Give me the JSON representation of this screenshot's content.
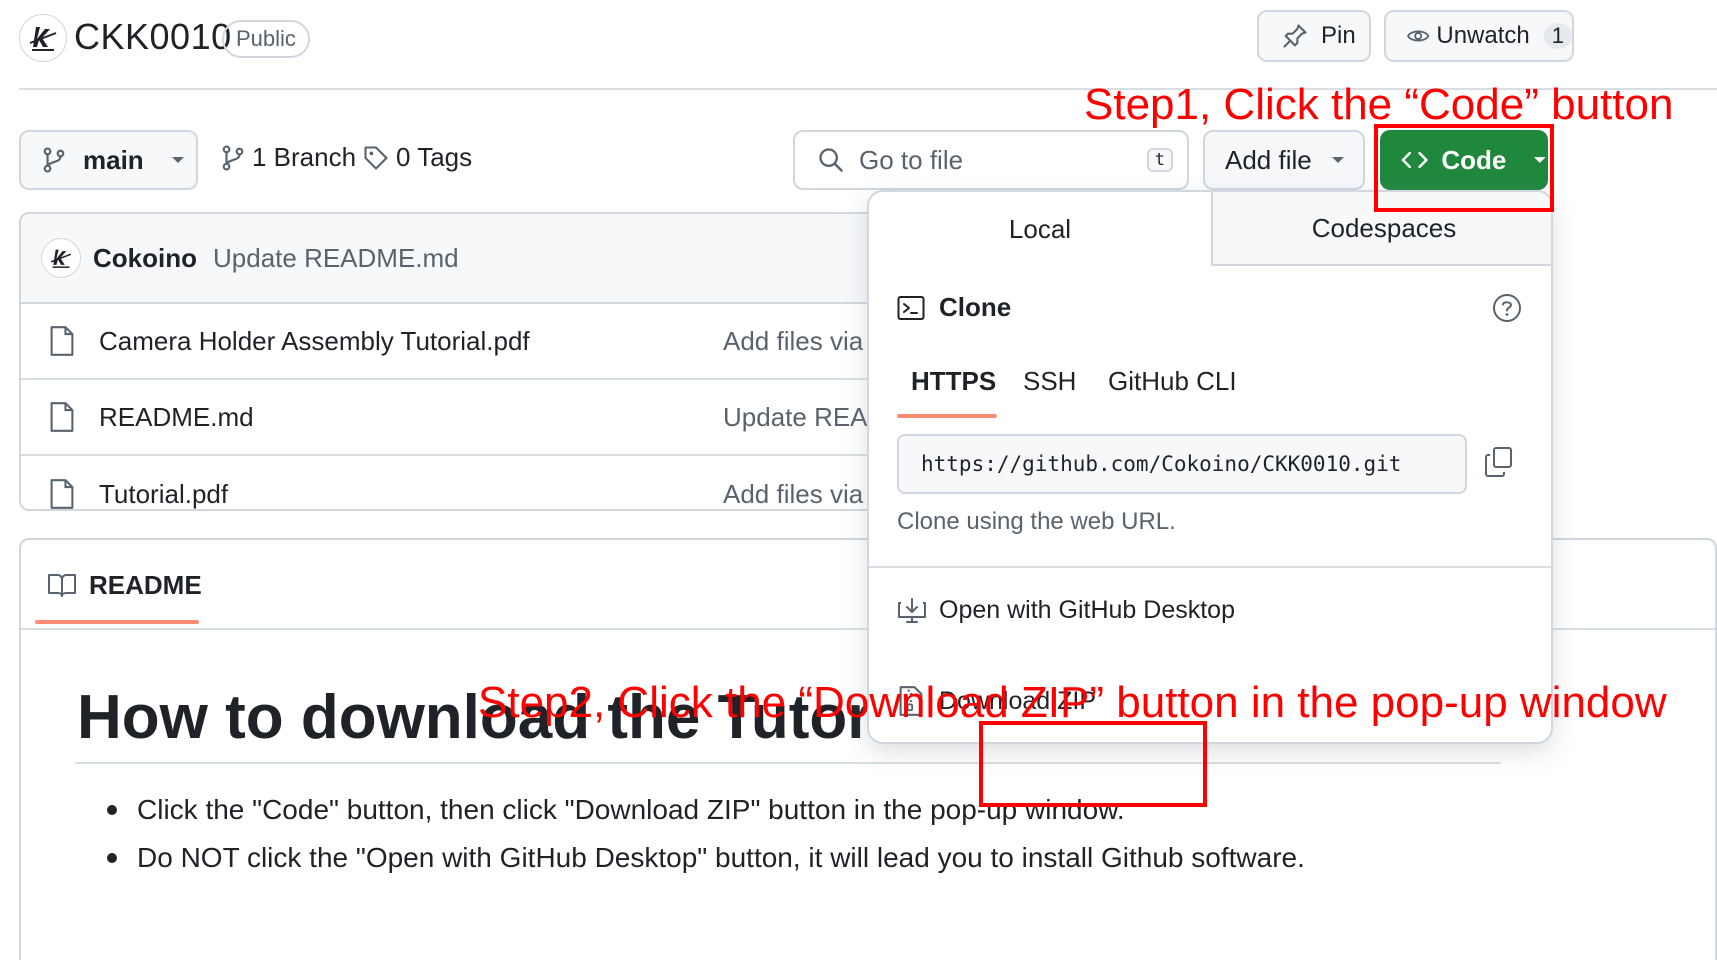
{
  "repo": {
    "name": "CKK0010",
    "visibility": "Public",
    "pin_label": "Pin",
    "unwatch_label": "Unwatch",
    "watch_count": "1"
  },
  "toolbar": {
    "branch": "main",
    "branches_count": "1 Branch",
    "tags_count": "0 Tags",
    "search_placeholder": "Go to file",
    "search_shortcut": "t",
    "add_file_label": "Add file",
    "code_label": "Code"
  },
  "commit": {
    "author": "Cokoino",
    "message": "Update README.md"
  },
  "files": [
    {
      "name": "Camera Holder Assembly Tutorial.pdf",
      "message": "Add files via upload"
    },
    {
      "name": "README.md",
      "message": "Update README.md"
    },
    {
      "name": "Tutorial.pdf",
      "message": "Add files via upload"
    }
  ],
  "readme": {
    "tab_label": "README",
    "heading": "How to download the Tutorial d",
    "bullets": [
      "Click the \"Code\" button, then click \"Download ZIP\" button in the pop-up window.",
      "Do NOT click the \"Open with GitHub Desktop\" button, it will lead you to install Github software."
    ]
  },
  "popup": {
    "tabs": [
      "Local",
      "Codespaces"
    ],
    "clone_title": "Clone",
    "sub_tabs": [
      "HTTPS",
      "SSH",
      "GitHub CLI"
    ],
    "clone_url": "https://github.com/Cokoino/CKK0010.git",
    "clone_hint": "Clone using the web URL.",
    "open_desktop_label": "Open with GitHub Desktop",
    "download_zip_label": "Download ZIP"
  },
  "annotations": {
    "step1": "Step1, Click the “Code” button",
    "step2": "Step2, Click the “Download ZIP” button in the pop-up window"
  },
  "colors": {
    "code_button": "#1f883d",
    "tab_underline": "#fd8c73",
    "annotation": "#ff0000",
    "border": "#d0d7de",
    "muted_text": "#59636e"
  }
}
